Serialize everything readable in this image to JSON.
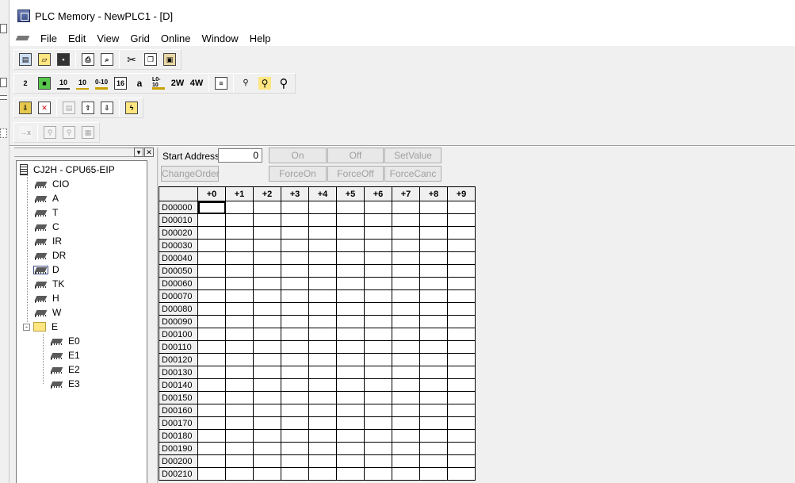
{
  "window": {
    "title": "PLC Memory - NewPLC1 - [D]"
  },
  "menu": [
    "File",
    "Edit",
    "View",
    "Grid",
    "Online",
    "Window",
    "Help"
  ],
  "toolbar": {
    "row2_labels": [
      "2",
      "",
      "10",
      "10",
      "0-10",
      "16",
      "a",
      "L0-10",
      "2W",
      "4W",
      "",
      "",
      "",
      ""
    ]
  },
  "tree": {
    "root": "CJ2H - CPU65-EIP",
    "areas": [
      "CIO",
      "A",
      "T",
      "C",
      "IR",
      "DR",
      "D",
      "TK",
      "H",
      "W"
    ],
    "folder": "E",
    "folder_expander": "-",
    "e_areas": [
      "E0",
      "E1",
      "E2",
      "E3"
    ],
    "selected": "D"
  },
  "controls": {
    "start_address_label": "Start Address:",
    "start_address_value": "0",
    "on": "On",
    "off": "Off",
    "set_value": "SetValue",
    "change_order": "ChangeOrder",
    "force_on": "ForceOn",
    "force_off": "ForceOff",
    "force_cancel": "ForceCanc"
  },
  "grid": {
    "columns": [
      "+0",
      "+1",
      "+2",
      "+3",
      "+4",
      "+5",
      "+6",
      "+7",
      "+8",
      "+9"
    ],
    "rows": [
      "D00000",
      "D00010",
      "D00020",
      "D00030",
      "D00040",
      "D00050",
      "D00060",
      "D00070",
      "D00080",
      "D00090",
      "D00100",
      "D00110",
      "D00120",
      "D00130",
      "D00140",
      "D00150",
      "D00160",
      "D00170",
      "D00180",
      "D00190",
      "D00200",
      "D00210"
    ]
  }
}
